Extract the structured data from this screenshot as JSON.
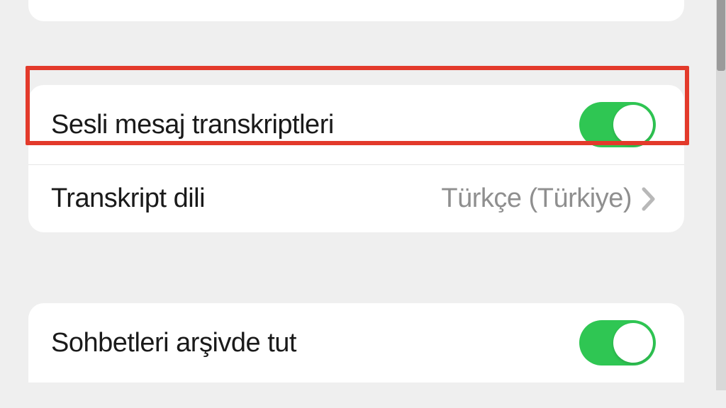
{
  "settings": {
    "voice_transcripts": {
      "label": "Sesli mesaj transkriptleri",
      "enabled": true
    },
    "transcript_language": {
      "label": "Transkript dili",
      "value": "Türkçe (Türkiye)"
    },
    "keep_archived": {
      "label": "Sohbetleri arşivde tut",
      "enabled": true
    }
  },
  "colors": {
    "toggle_on": "#2fc653",
    "highlight": "#e33a2b"
  }
}
